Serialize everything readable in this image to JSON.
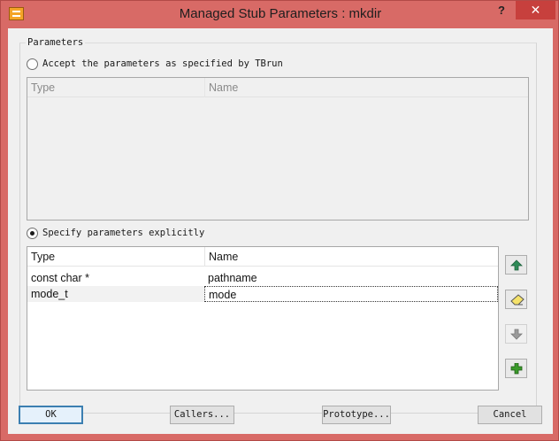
{
  "window": {
    "title": "Managed Stub Parameters : mkdir",
    "help_label": "?",
    "close_label": "✕"
  },
  "group": {
    "label": "Parameters"
  },
  "option_tbrun": {
    "label": "Accept the parameters as specified by TBrun",
    "checked": false
  },
  "tbrun_table": {
    "columns": [
      "Type",
      "Name"
    ],
    "rows": []
  },
  "option_explicit": {
    "label": "Specify parameters explicitly",
    "checked": true
  },
  "params_table": {
    "columns": [
      "Type",
      "Name"
    ],
    "rows": [
      {
        "type": "const char *",
        "name": "pathname"
      },
      {
        "type": "mode_t",
        "name": "mode"
      }
    ]
  },
  "side_buttons": {
    "move_up": "arrow-up-icon",
    "edit": "eraser-icon",
    "move_down": "arrow-down-icon",
    "add": "plus-icon"
  },
  "footer": {
    "ok_label": "OK",
    "callers_label": "Callers...",
    "prototype_label": "Prototype...",
    "cancel_label": "Cancel"
  },
  "colors": {
    "title_bar": "#d86a66",
    "close_button": "#c7403d",
    "dialog_bg": "#f0f0f0",
    "up_arrow": "#2e8b57",
    "add_plus": "#3a9a2a",
    "eraser": "#f5e26a"
  }
}
